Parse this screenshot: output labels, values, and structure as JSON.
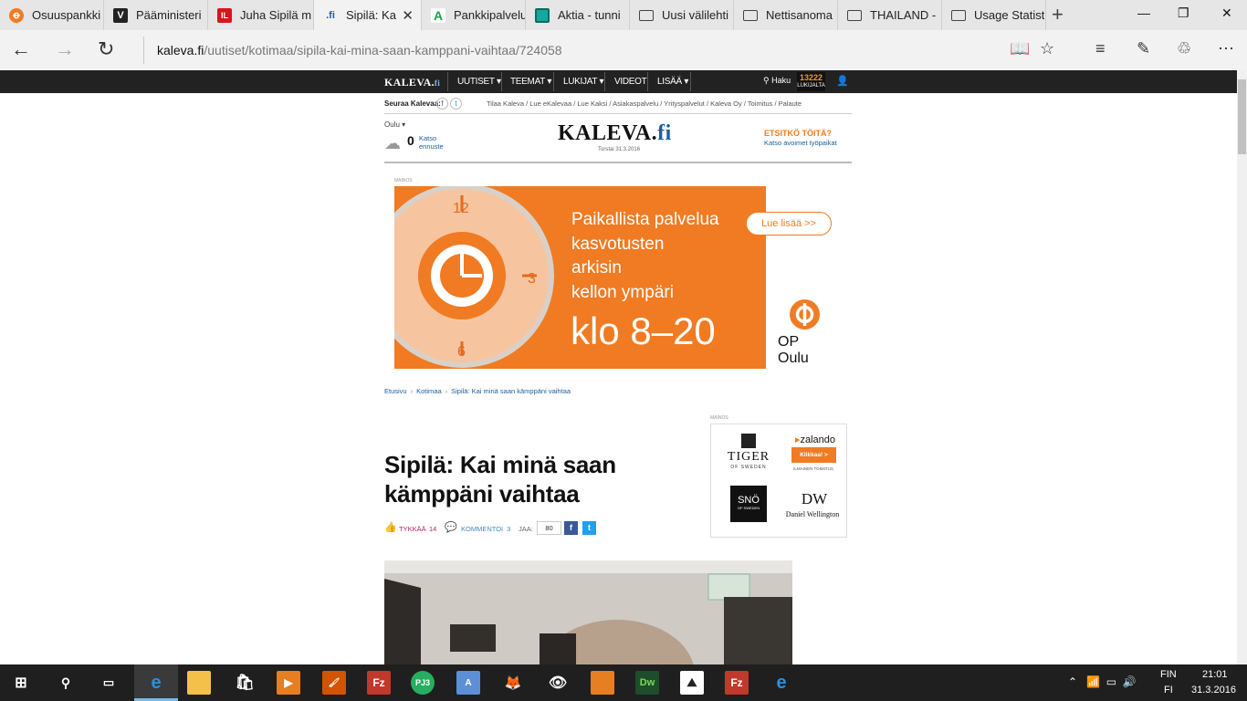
{
  "tabs": [
    {
      "label": "Osuuspankki",
      "favicon": "op-logo-icon",
      "fav_color": "#f07b23",
      "fav_glyph": "ꝋ"
    },
    {
      "label": "Pääministeri",
      "favicon": "ministry-logo-icon",
      "fav_color": "#222222",
      "fav_glyph": "V"
    },
    {
      "label": "Juha Sipilä m",
      "favicon": "il-logo-icon",
      "fav_color": "#d8141d",
      "fav_glyph": "IL"
    },
    {
      "label": "Sipilä: Ka",
      "favicon": "kaleva-logo-icon",
      "fav_color": "#1a5fa0",
      "fav_glyph": ".fi",
      "active": true
    },
    {
      "label": "Pankkipalvelu",
      "favicon": "aktia-a-icon",
      "fav_color": "#ffffff",
      "fav_glyph": "A"
    },
    {
      "label": "Aktia - tunni",
      "favicon": "aktia-square-icon",
      "fav_color": "#13a89e",
      "fav_glyph": ""
    },
    {
      "label": "Uusi välilehti",
      "favicon": "page-icon",
      "fav_color": "#e6e6e6",
      "fav_glyph": "▭"
    },
    {
      "label": "Nettisanoma",
      "favicon": "page-icon",
      "fav_color": "#e6e6e6",
      "fav_glyph": "▭"
    },
    {
      "label": "THAILAND -",
      "favicon": "page-icon",
      "fav_color": "#e6e6e6",
      "fav_glyph": "▭"
    },
    {
      "label": "Usage Statist",
      "favicon": "page-icon",
      "fav_color": "#e6e6e6",
      "fav_glyph": "▭"
    }
  ],
  "url": {
    "host": "kaleva.fi",
    "path": "/uutiset/kotimaa/sipila-kai-mina-saan-kamppani-vaihtaa/724058"
  },
  "site": {
    "logo": "KALEVA.",
    "logo_fi": "fi",
    "nav": [
      "UUTISET",
      "TEEMAT",
      "LUKIJAT",
      "VIDEOT",
      "LISÄÄ"
    ],
    "search_label": "Haku",
    "badge_number": "13222",
    "badge_label": "LUKIJALTA",
    "follow_label": "Seuraa Kalevaa:",
    "top_links": "Tilaa Kaleva  /  Lue eKalevaa  /  Lue Kaksi  /  Asiakaspalvelu  /  Yrityspalvelut  /  Kaleva Oy  /  Toimitus  /  Palaute",
    "weather_city": "Oulu",
    "weather_temp": "0",
    "weather_link": "Katso ennuste",
    "masthead_date": "Torstai 31.3.2016",
    "jobs_title": "ETSITKÖ TÖITÄ?",
    "jobs_link": "Katso avoimet työpaikat"
  },
  "ad": {
    "label": "MAINOS",
    "lines": [
      "Paikallista palvelua",
      "kasvotusten",
      "arkisin",
      "kellon ympäri"
    ],
    "hours": "klo 8–20",
    "button": "Lue lisää  >>",
    "brand": "OP Oulu",
    "clock_numbers": [
      "12",
      "3",
      "6"
    ]
  },
  "breadcrumb": [
    "Etusivu",
    "Kotimaa",
    "Sipilä: Kai minä saan kämppäni vaihtaa"
  ],
  "sidebar_ad": {
    "label": "MAINOS",
    "tiger": "TIGER",
    "tiger_sub": "OF SWEDEN",
    "zalando": "zalando",
    "zalando_btn": "Klikkaa!  >",
    "zalando_sub": "ILMAINEN TOIMITUS",
    "sno": "SNÖ",
    "sno_sub": "OF SWEDEN",
    "dw": "DW",
    "dw_sub": "Daniel Wellington"
  },
  "article": {
    "headline": "Sipilä: Kai minä saan kämppäni vaihtaa",
    "like_label": "TYKKÄÄ",
    "like_count": "14",
    "comment_label": "KOMMENTOI",
    "comment_count": "3",
    "share_label": "JAA:",
    "share_count": "80"
  },
  "taskbar": {
    "lang_top": "FIN",
    "lang_bottom": "FI",
    "time": "21:01",
    "date": "31.3.2016"
  },
  "colors": {
    "accent": "#f07b23",
    "link": "#1a5fa0",
    "like": "#b8226a",
    "comment": "#3c8dbc",
    "facebook": "#3b5998",
    "twitter": "#1da1f2"
  }
}
